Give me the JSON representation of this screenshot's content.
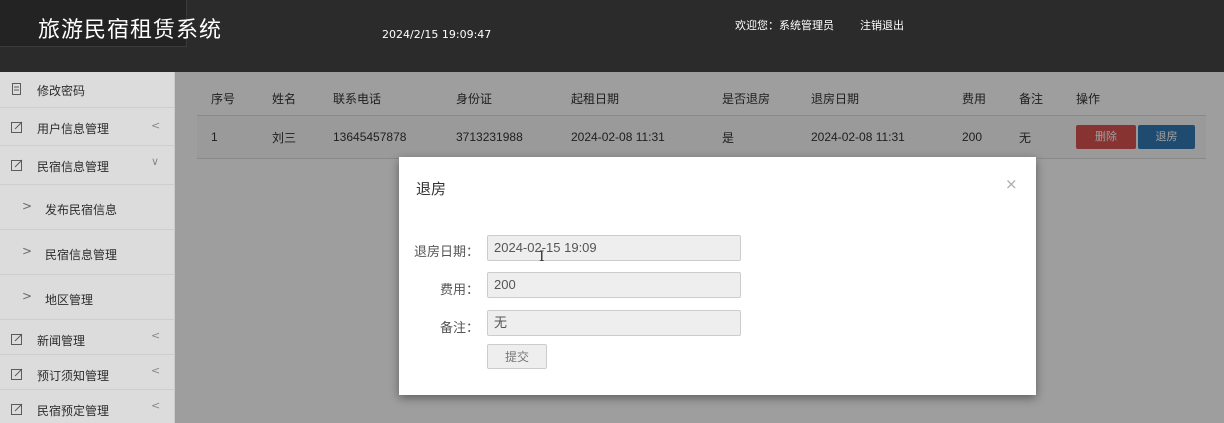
{
  "header": {
    "app_title": "旅游民宿租赁系统",
    "datetime": "2024/2/15 19:09:47",
    "welcome": "欢迎您：系统管理员",
    "logout": "注销退出"
  },
  "sidebar": {
    "items": [
      {
        "label": "修改密码",
        "icon": "document-icon"
      },
      {
        "label": "用户信息管理",
        "icon": "edit-icon",
        "chevron": "<"
      },
      {
        "label": "民宿信息管理",
        "icon": "edit-icon",
        "chevron": "∨"
      },
      {
        "label": "发布民宿信息",
        "arrow": ">"
      },
      {
        "label": "民宿信息管理",
        "arrow": ">"
      },
      {
        "label": "地区管理",
        "arrow": ">"
      },
      {
        "label": "新闻管理",
        "icon": "edit-icon",
        "chevron": "<"
      },
      {
        "label": "预订须知管理",
        "icon": "edit-icon",
        "chevron": "<"
      },
      {
        "label": "民宿预定管理",
        "icon": "edit-icon",
        "chevron": "<"
      }
    ]
  },
  "table": {
    "headers": [
      "序号",
      "姓名",
      "联系电话",
      "身份证",
      "起租日期",
      "是否退房",
      "退房日期",
      "费用",
      "备注",
      "操作"
    ],
    "rows": [
      {
        "index": "1",
        "name": "刘三",
        "phone": "13645457878",
        "id_card": "3713231988",
        "start_date": "2024-02-08 11:31",
        "checked_out": "是",
        "checkout_date": "2024-02-08 11:31",
        "fee": "200",
        "note": "无",
        "delete_label": "删除",
        "checkout_label": "退房"
      }
    ],
    "colors": {
      "delete": "#d9534f",
      "checkout": "#337ab7"
    }
  },
  "modal": {
    "title": "退房",
    "close": "×",
    "fields": [
      {
        "label": "退房日期：",
        "value": "2024-02-15 19:09"
      },
      {
        "label": "费用：",
        "value": "200"
      },
      {
        "label": "备注：",
        "value": "无"
      }
    ],
    "submit_label": "提交"
  }
}
